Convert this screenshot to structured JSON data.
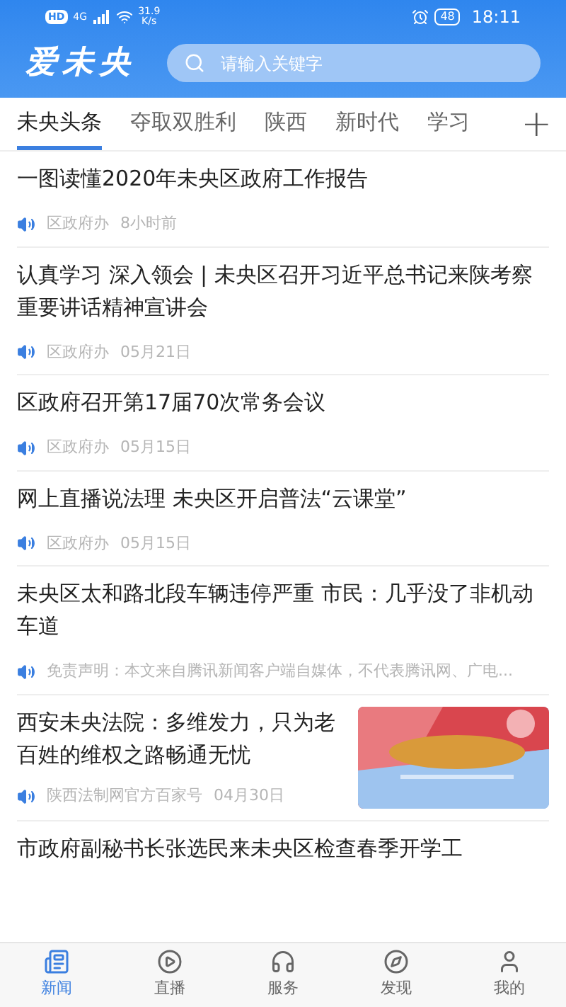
{
  "status_bar": {
    "hd": "HD",
    "network": "4G",
    "speed": "31.9",
    "speed_unit": "K/s",
    "battery": "48",
    "time": "18:11"
  },
  "header": {
    "logo": "爱未央",
    "search": {
      "placeholder": "请输入关键字"
    }
  },
  "tabs": [
    {
      "label": "未央头条",
      "selected": true
    },
    {
      "label": "夺取双胜利",
      "selected": false
    },
    {
      "label": "陕西",
      "selected": false
    },
    {
      "label": "新时代",
      "selected": false
    },
    {
      "label": "学习",
      "selected": false
    }
  ],
  "add_tab": "+",
  "news": [
    {
      "kind": "text",
      "title": "一图读懂2020年未央区政府工作报告",
      "source": "区政府办",
      "time": "8小时前"
    },
    {
      "kind": "text",
      "title": "认真学习 深入领会 | 未央区召开习近平总书记来陕考察重要讲话精神宣讲会",
      "source": "区政府办",
      "time": "05月21日"
    },
    {
      "kind": "text",
      "title": "区政府召开第17届70次常务会议",
      "source": "区政府办",
      "time": "05月15日"
    },
    {
      "kind": "text",
      "title": "网上直播说法理 未央区开启普法“云课堂”",
      "source": "区政府办",
      "time": "05月15日"
    },
    {
      "kind": "text",
      "title": "未央区太和路北段车辆违停严重 市民：几乎没了非机动车道",
      "source": "免责声明：本文来自腾讯新闻客户端自媒体，不代表腾讯网、广电..."
    },
    {
      "kind": "picture",
      "title": "西安未央法院：多维发力，只为老百姓的维权之路畅通无忧",
      "source": "陕西法制网官方百家号",
      "time": "04月30日"
    },
    {
      "kind": "text",
      "title": "市政府副秘书长张选民来未央区检查春季开学工"
    }
  ],
  "bottom_nav": [
    {
      "label": "新闻",
      "selected": true
    },
    {
      "label": "直播",
      "selected": false
    },
    {
      "label": "服务",
      "selected": false
    },
    {
      "label": "发现",
      "selected": false
    },
    {
      "label": "我的",
      "selected": false
    }
  ]
}
